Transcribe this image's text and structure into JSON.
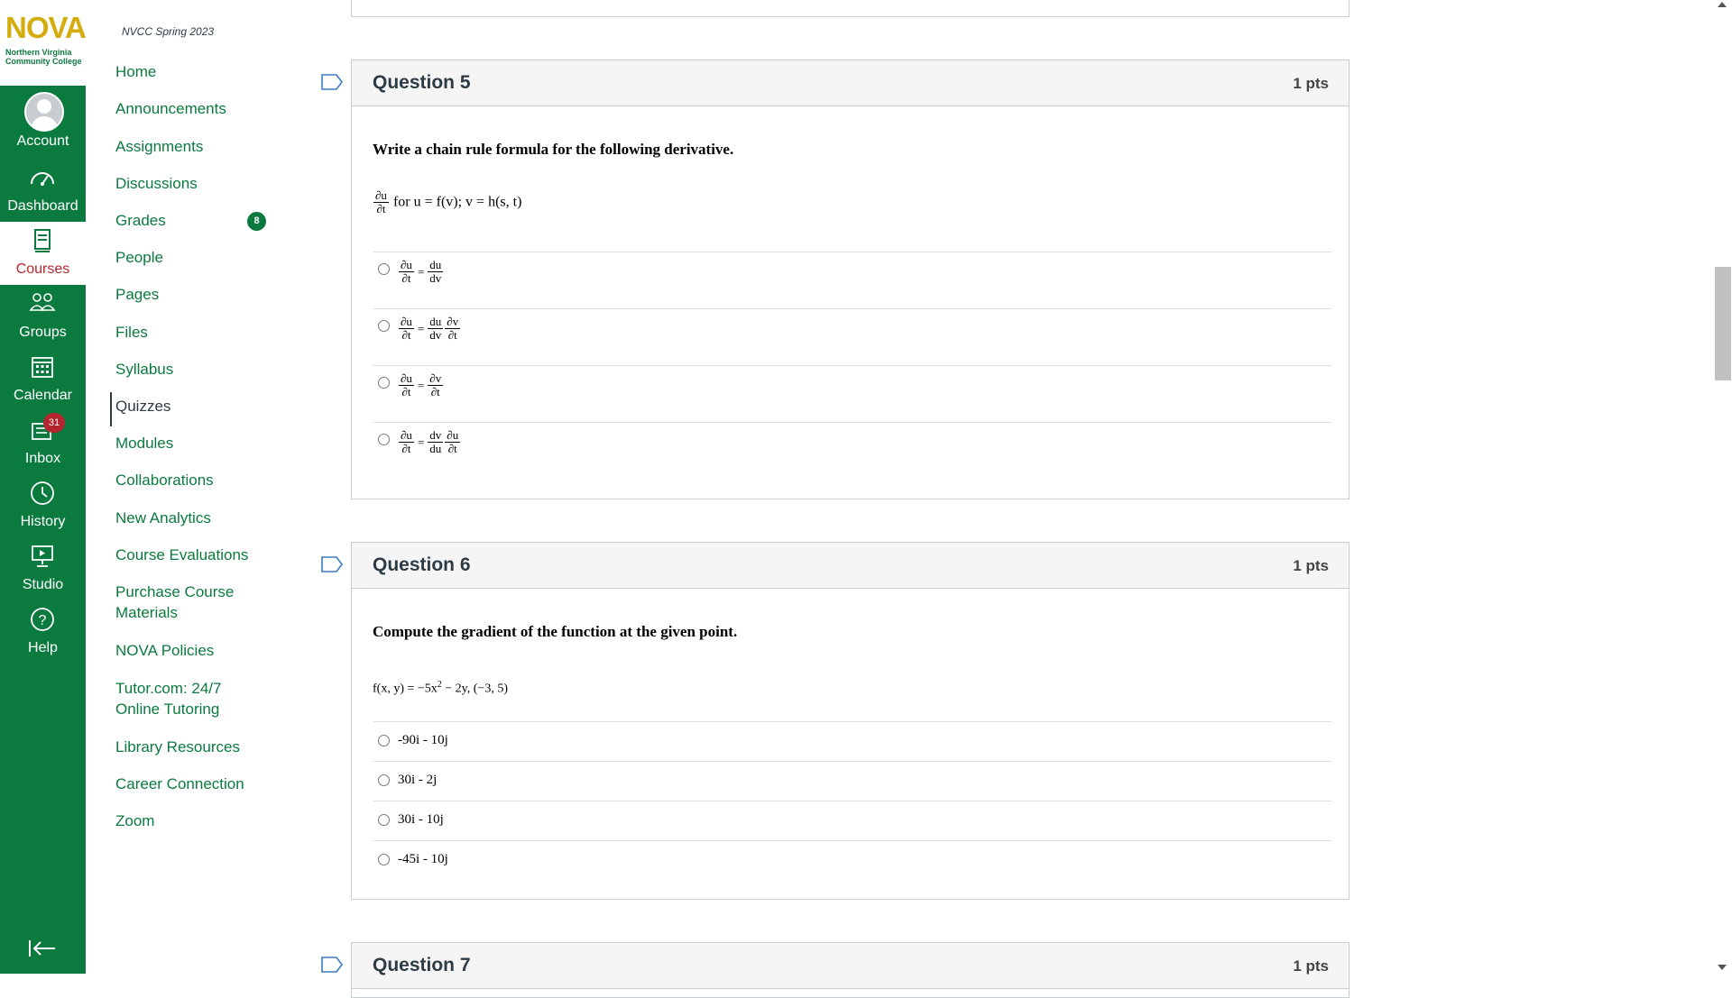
{
  "brand": {
    "logo_text": "NOVA",
    "logo_subtext": "Northern Virginia Community College",
    "primary_color": "#0b7a3e",
    "logo_color": "#d4ac0d",
    "badge_color": "#b3262f"
  },
  "global_nav": {
    "items": [
      {
        "label": "Account",
        "icon": "user-avatar-icon"
      },
      {
        "label": "Dashboard",
        "icon": "dashboard-gauge-icon"
      },
      {
        "label": "Courses",
        "icon": "courses-book-icon",
        "active": true
      },
      {
        "label": "Groups",
        "icon": "groups-people-icon"
      },
      {
        "label": "Calendar",
        "icon": "calendar-icon"
      },
      {
        "label": "Inbox",
        "icon": "inbox-icon",
        "badge": "31"
      },
      {
        "label": "History",
        "icon": "history-clock-icon"
      },
      {
        "label": "Studio",
        "icon": "studio-icon"
      },
      {
        "label": "Help",
        "icon": "help-question-icon"
      }
    ],
    "collapse_icon": "collapse-arrow-icon"
  },
  "course_nav": {
    "term": "NVCC Spring 2023",
    "items": [
      {
        "label": "Home"
      },
      {
        "label": "Announcements"
      },
      {
        "label": "Assignments"
      },
      {
        "label": "Discussions"
      },
      {
        "label": "Grades",
        "badge": "8"
      },
      {
        "label": "People"
      },
      {
        "label": "Pages"
      },
      {
        "label": "Files"
      },
      {
        "label": "Syllabus"
      },
      {
        "label": "Quizzes",
        "active": true
      },
      {
        "label": "Modules"
      },
      {
        "label": "Collaborations"
      },
      {
        "label": "New Analytics"
      },
      {
        "label": "Course Evaluations"
      },
      {
        "label": "Purchase Course Materials"
      },
      {
        "label": "NOVA Policies"
      },
      {
        "label": "Tutor.com: 24/7 Online Tutoring"
      },
      {
        "label": "Library Resources"
      },
      {
        "label": "Career Connection"
      },
      {
        "label": "Zoom"
      }
    ]
  },
  "questions": [
    {
      "title": "Question 5",
      "points": "1 pts",
      "text": "Write a chain rule formula for the following derivative.",
      "formula": {
        "lead": {
          "num": "∂u",
          "den": "∂t"
        },
        "rest": "for u = f(v); v = h(s, t)"
      },
      "answers": [
        {
          "lhs": {
            "num": "∂u",
            "den": "∂t"
          },
          "rhs": [
            {
              "num": "du",
              "den": "dv"
            }
          ]
        },
        {
          "lhs": {
            "num": "∂u",
            "den": "∂t"
          },
          "rhs": [
            {
              "num": "du",
              "den": "dv"
            },
            {
              "num": "∂v",
              "den": "∂t"
            }
          ]
        },
        {
          "lhs": {
            "num": "∂u",
            "den": "∂t"
          },
          "rhs": [
            {
              "num": "∂v",
              "den": "∂t"
            }
          ]
        },
        {
          "lhs": {
            "num": "∂u",
            "den": "∂t"
          },
          "rhs": [
            {
              "num": "dv",
              "den": "du"
            },
            {
              "num": "∂u",
              "den": "∂t"
            }
          ]
        }
      ]
    },
    {
      "title": "Question 6",
      "points": "1 pts",
      "text": "Compute the gradient of the function at the given point.",
      "formula_text": "f(x, y) = −5x",
      "formula_sup": "2",
      "formula_tail": " − 2y,  (−3, 5)",
      "answers": [
        "-90i - 10j",
        "30i - 2j",
        "30i - 10j",
        "-45i - 10j"
      ]
    },
    {
      "title": "Question 7",
      "points": "1 pts"
    }
  ],
  "symbols": {
    "equals": "=",
    "flag_icon": "question-flag-icon"
  }
}
